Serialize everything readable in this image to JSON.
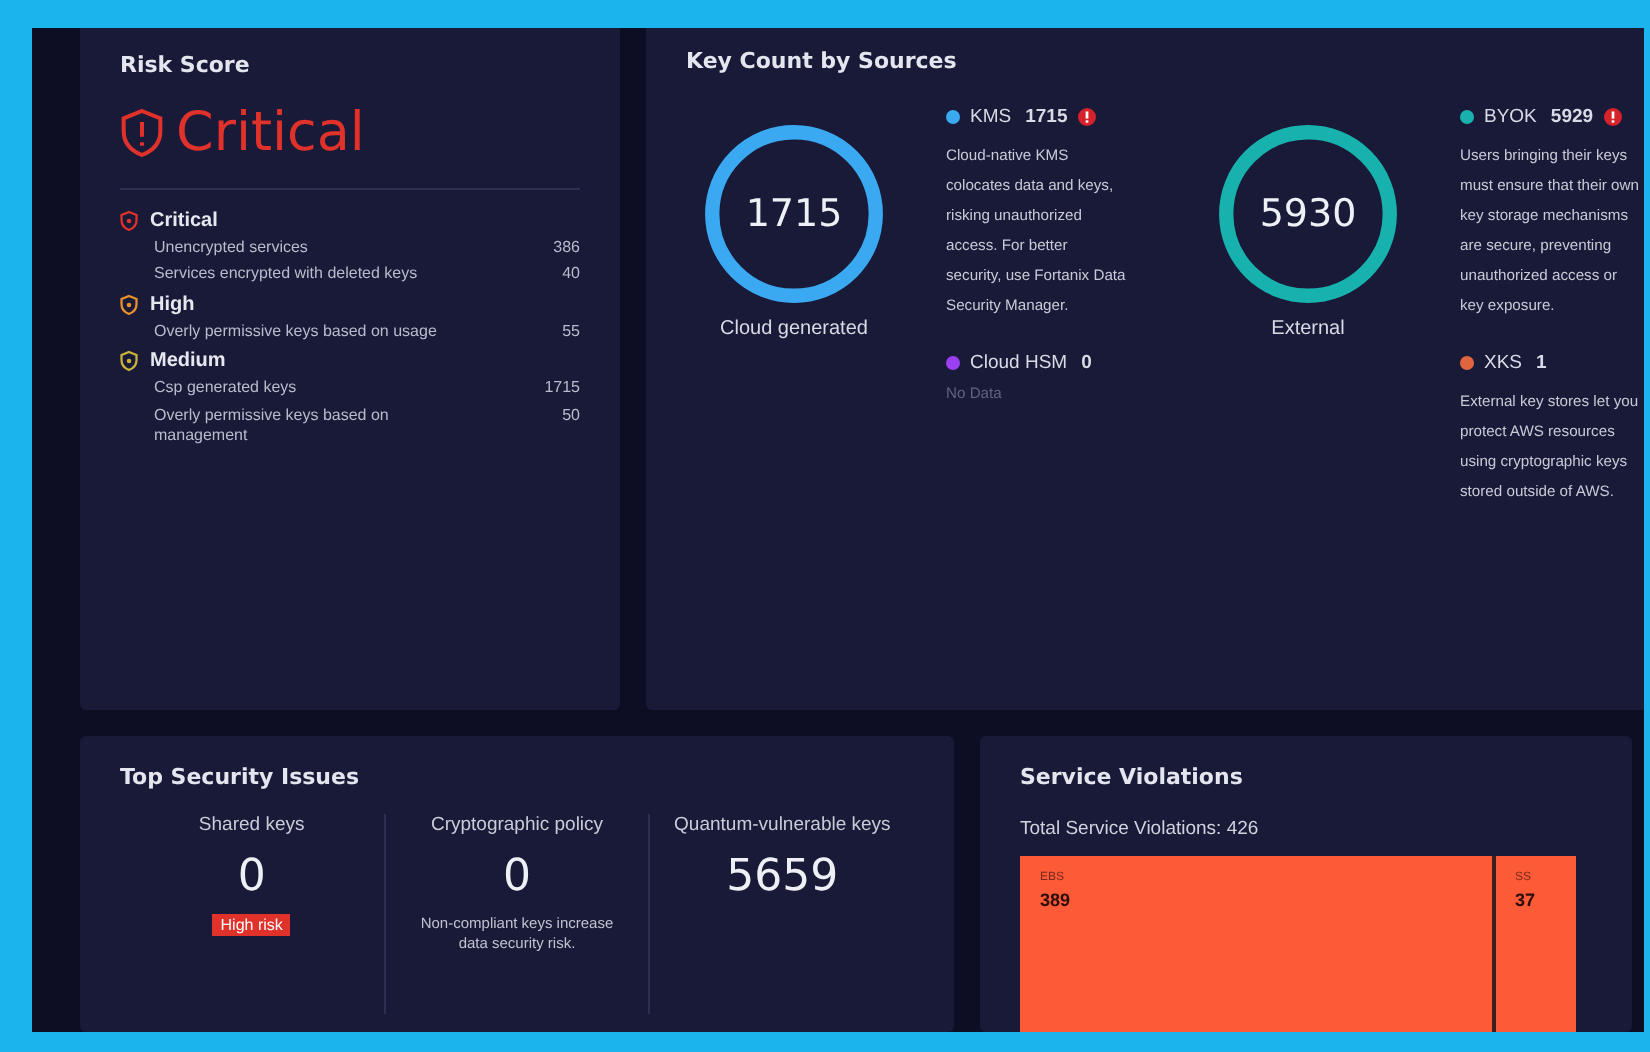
{
  "risk_score": {
    "title": "Risk Score",
    "level": "Critical",
    "groups": [
      {
        "severity": "Critical",
        "color": "#e0322b",
        "items": [
          {
            "label": "Unencrypted services",
            "count": "386"
          },
          {
            "label": "Services encrypted with deleted keys",
            "count": "40"
          }
        ]
      },
      {
        "severity": "High",
        "color": "#e8902c",
        "items": [
          {
            "label": "Overly permissive keys based on usage",
            "count": "55"
          }
        ]
      },
      {
        "severity": "Medium",
        "color": "#c9b43a",
        "items": [
          {
            "label": "Csp generated keys",
            "count": "1715"
          },
          {
            "label": "Overly permissive keys based on management",
            "count": "50"
          }
        ]
      }
    ]
  },
  "key_count": {
    "title": "Key Count by Sources",
    "groups": [
      {
        "total": "1715",
        "label": "Cloud generated",
        "sources": [
          {
            "name": "KMS",
            "count": "1715",
            "alert": true,
            "color": "#3ba9f2",
            "description": "Cloud-native KMS colocates data and keys, risking unauthorized access. For better security, use Fortanix Data Security Manager."
          },
          {
            "name": "Cloud HSM",
            "count": "0",
            "alert": false,
            "color": "#9a3ff2",
            "description": "No Data",
            "muted": true
          }
        ]
      },
      {
        "total": "5930",
        "label": "External",
        "sources": [
          {
            "name": "BYOK",
            "count": "5929",
            "alert": true,
            "color": "#17b2ad",
            "description": "Users bringing their keys must ensure that their own key storage mechanisms are secure, preventing unauthorized access or key exposure."
          },
          {
            "name": "XKS",
            "count": "1",
            "alert": false,
            "color": "#e0653f",
            "description": "External key stores let you protect AWS resources using cryptographic keys stored outside of AWS."
          }
        ]
      }
    ]
  },
  "top_security_issues": {
    "title": "Top Security Issues",
    "metrics": [
      {
        "label": "Shared keys",
        "value": "0",
        "badge": "High risk"
      },
      {
        "label": "Cryptographic policy",
        "value": "0",
        "note": "Non-compliant keys increase data security risk."
      },
      {
        "label": "Quantum-vulnerable keys",
        "value": "5659"
      }
    ]
  },
  "service_violations": {
    "title": "Service Violations",
    "total": "Total Service Violations: 426",
    "tiles": [
      {
        "label": "EBS",
        "value": "389"
      },
      {
        "label": "SS",
        "value": "37"
      }
    ]
  }
}
